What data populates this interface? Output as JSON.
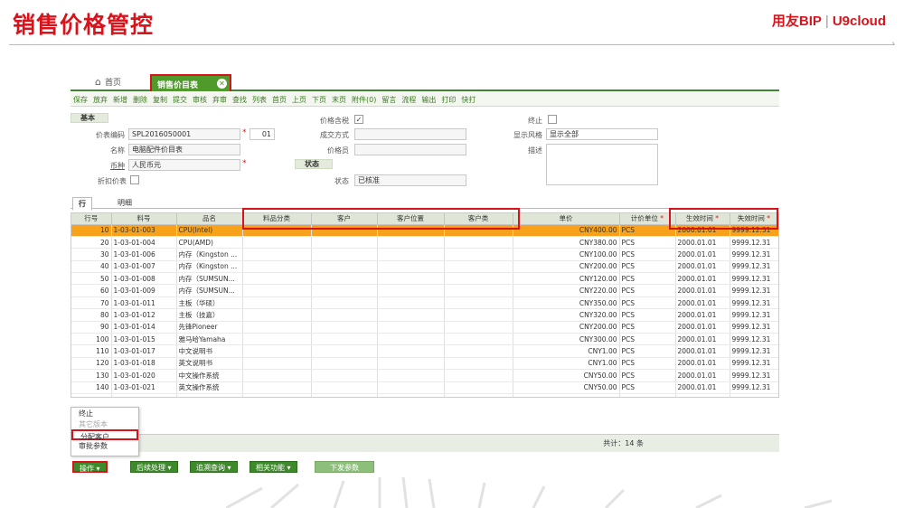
{
  "slide": {
    "title": "销售价格管控",
    "brand_left": "用友BIP",
    "brand_sep": "|",
    "brand_right": "U9cloud"
  },
  "tabs": {
    "home_label": "首页",
    "active_label": "销售价目表"
  },
  "toolbar": [
    "保存",
    "放弃",
    "新增",
    "删除",
    "复制",
    "提交",
    "审核",
    "弃审",
    "查找",
    "列表",
    "首页",
    "上页",
    "下页",
    "末页",
    "附件(0)",
    "留言",
    "流程",
    "输出",
    "打印",
    "快打"
  ],
  "form": {
    "section_basic": "基本",
    "section_status": "状态",
    "code_label": "价表编码",
    "code_value": "SPL2016050001",
    "code_suffix": "01",
    "name_label": "名称",
    "name_value": "电脑配件价目表",
    "currency_label": "币种",
    "currency_value": "人民币元",
    "discount_label": "折扣价表",
    "tax_label": "价格含税",
    "deal_label": "成交方式",
    "price_group_label": "价格员",
    "status_label": "状态",
    "status_value": "已核准",
    "stop_label": "终止",
    "display_label": "显示风格",
    "display_value": "显示全部",
    "desc_label": "描述"
  },
  "subtabs": {
    "row": "行",
    "detail": "明细"
  },
  "grid": {
    "headers": [
      "行号",
      "料号",
      "品名",
      "料品分类",
      "客户",
      "客户位置",
      "客户类",
      "单价",
      "计价单位",
      "生效时间",
      "失效时间"
    ],
    "rows": [
      [
        "10",
        "1-03-01-003",
        "CPU(Intel)",
        "",
        "",
        "",
        "",
        "CNY400.00",
        "PCS",
        "2000.01.01",
        "9999.12.31"
      ],
      [
        "20",
        "1-03-01-004",
        "CPU(AMD)",
        "",
        "",
        "",
        "",
        "CNY380.00",
        "PCS",
        "2000.01.01",
        "9999.12.31"
      ],
      [
        "30",
        "1-03-01-006",
        "内存（Kingston ...",
        "",
        "",
        "",
        "",
        "CNY100.00",
        "PCS",
        "2000.01.01",
        "9999.12.31"
      ],
      [
        "40",
        "1-03-01-007",
        "内存（Kingston ...",
        "",
        "",
        "",
        "",
        "CNY200.00",
        "PCS",
        "2000.01.01",
        "9999.12.31"
      ],
      [
        "50",
        "1-03-01-008",
        "内存（SUMSUN...",
        "",
        "",
        "",
        "",
        "CNY120.00",
        "PCS",
        "2000.01.01",
        "9999.12.31"
      ],
      [
        "60",
        "1-03-01-009",
        "内存（SUMSUN...",
        "",
        "",
        "",
        "",
        "CNY220.00",
        "PCS",
        "2000.01.01",
        "9999.12.31"
      ],
      [
        "70",
        "1-03-01-011",
        "主板（华硕）",
        "",
        "",
        "",
        "",
        "CNY350.00",
        "PCS",
        "2000.01.01",
        "9999.12.31"
      ],
      [
        "80",
        "1-03-01-012",
        "主板（技嘉）",
        "",
        "",
        "",
        "",
        "CNY320.00",
        "PCS",
        "2000.01.01",
        "9999.12.31"
      ],
      [
        "90",
        "1-03-01-014",
        "先锋Pioneer",
        "",
        "",
        "",
        "",
        "CNY200.00",
        "PCS",
        "2000.01.01",
        "9999.12.31"
      ],
      [
        "100",
        "1-03-01-015",
        "雅马哈Yamaha",
        "",
        "",
        "",
        "",
        "CNY300.00",
        "PCS",
        "2000.01.01",
        "9999.12.31"
      ],
      [
        "110",
        "1-03-01-017",
        "中文说明书",
        "",
        "",
        "",
        "",
        "CNY1.00",
        "PCS",
        "2000.01.01",
        "9999.12.31"
      ],
      [
        "120",
        "1-03-01-018",
        "英文说明书",
        "",
        "",
        "",
        "",
        "CNY1.00",
        "PCS",
        "2000.01.01",
        "9999.12.31"
      ],
      [
        "130",
        "1-03-01-020",
        "中文操作系统",
        "",
        "",
        "",
        "",
        "CNY50.00",
        "PCS",
        "2000.01.01",
        "9999.12.31"
      ],
      [
        "140",
        "1-03-01-021",
        "英文操作系统",
        "",
        "",
        "",
        "",
        "CNY50.00",
        "PCS",
        "2000.01.01",
        "9999.12.31"
      ]
    ],
    "selected_row": 0,
    "total": "共计：14 条"
  },
  "popup": {
    "items": [
      "终止",
      "其它版本",
      "分配客户",
      "审批参数"
    ]
  },
  "actions": [
    "操作",
    "后续处理",
    "追溯查询",
    "相关功能",
    "下发参数"
  ],
  "colors": {
    "accent": "#d9131b",
    "green": "#3d8a2a",
    "selected": "#f7a21a"
  }
}
